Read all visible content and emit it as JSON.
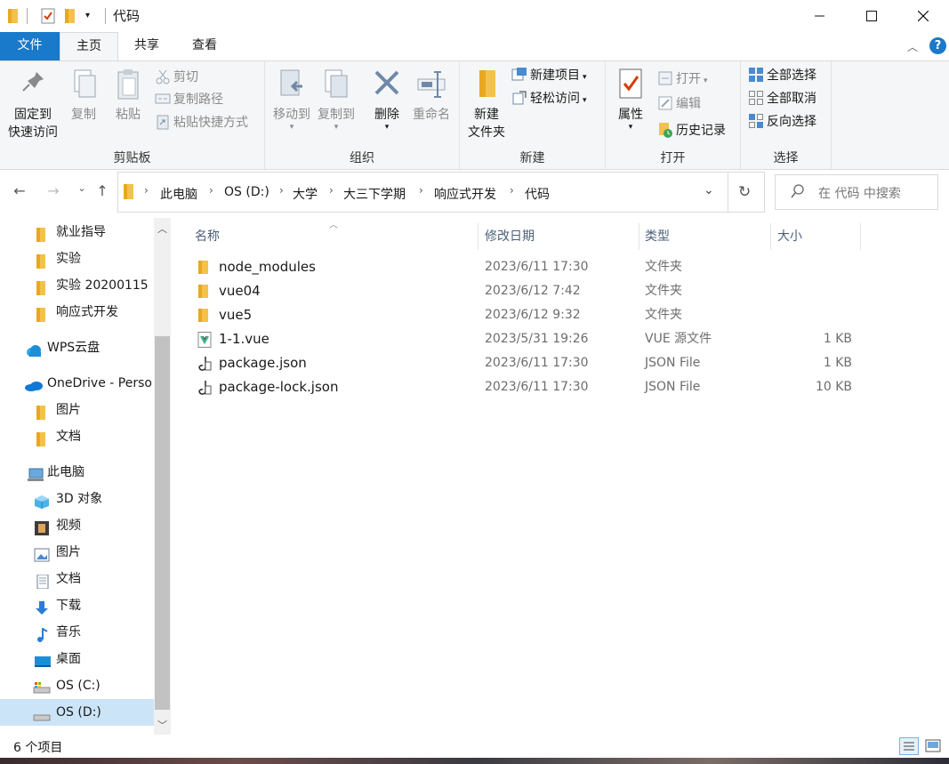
{
  "window": {
    "title": "代码"
  },
  "colors": {
    "accent": "#1979ca",
    "folder": "#f3c24b",
    "selection": "#cce4f7"
  },
  "tabs": {
    "file": "文件",
    "home": "主页",
    "share": "共享",
    "view": "查看"
  },
  "ribbon": {
    "clipboard": {
      "label": "剪贴板",
      "pin_line1": "固定到",
      "pin_line2": "快速访问",
      "copy": "复制",
      "paste": "粘贴",
      "cut": "剪切",
      "copy_path": "复制路径",
      "paste_shortcut": "粘贴快捷方式"
    },
    "organize": {
      "label": "组织",
      "move_to": "移动到",
      "copy_to": "复制到",
      "delete": "删除",
      "rename": "重命名"
    },
    "new": {
      "label": "新建",
      "new_folder_line1": "新建",
      "new_folder_line2": "文件夹",
      "new_item": "新建项目",
      "easy_access": "轻松访问"
    },
    "open": {
      "label": "打开",
      "properties": "属性",
      "open": "打开",
      "edit": "编辑",
      "history": "历史记录"
    },
    "select": {
      "label": "选择",
      "select_all": "全部选择",
      "select_none": "全部取消",
      "invert": "反向选择"
    }
  },
  "address": {
    "crumbs": [
      "此电脑",
      "OS (D:)",
      "大学",
      "大三下学期",
      "响应式开发",
      "代码"
    ]
  },
  "search": {
    "placeholder": "在 代码 中搜索"
  },
  "navpane": {
    "items": [
      {
        "label": "就业指导",
        "icon": "folder-icon"
      },
      {
        "label": "实验",
        "icon": "folder-icon"
      },
      {
        "label": "实验 20200115",
        "icon": "folder-icon"
      },
      {
        "label": "响应式开发",
        "icon": "folder-icon"
      },
      {
        "label": "WPS云盘",
        "icon": "cloud-icon"
      },
      {
        "label": "OneDrive - Perso",
        "icon": "onedrive-icon"
      },
      {
        "label": "图片",
        "icon": "folder-icon"
      },
      {
        "label": "文档",
        "icon": "folder-icon"
      },
      {
        "label": "此电脑",
        "icon": "computer-icon"
      },
      {
        "label": "3D 对象",
        "icon": "cube-icon"
      },
      {
        "label": "视频",
        "icon": "film-icon"
      },
      {
        "label": "图片",
        "icon": "picture-icon"
      },
      {
        "label": "文档",
        "icon": "document-icon"
      },
      {
        "label": "下载",
        "icon": "download-icon"
      },
      {
        "label": "音乐",
        "icon": "music-icon"
      },
      {
        "label": "桌面",
        "icon": "desktop-icon"
      },
      {
        "label": "OS (C:)",
        "icon": "drive-c-icon"
      },
      {
        "label": "OS (D:)",
        "icon": "drive-d-icon"
      }
    ]
  },
  "list": {
    "headers": {
      "name": "名称",
      "date": "修改日期",
      "type": "类型",
      "size": "大小"
    },
    "rows": [
      {
        "name": "node_modules",
        "date": "2023/6/11 17:30",
        "type": "文件夹",
        "size": "",
        "icon": "folder-icon"
      },
      {
        "name": "vue04",
        "date": "2023/6/12 7:42",
        "type": "文件夹",
        "size": "",
        "icon": "folder-icon"
      },
      {
        "name": "vue5",
        "date": "2023/6/12 9:32",
        "type": "文件夹",
        "size": "",
        "icon": "folder-icon"
      },
      {
        "name": "1-1.vue",
        "date": "2023/5/31 19:26",
        "type": "VUE 源文件",
        "size": "1 KB",
        "icon": "vue-file-icon"
      },
      {
        "name": "package.json",
        "date": "2023/6/11 17:30",
        "type": "JSON File",
        "size": "1 KB",
        "icon": "json-file-icon"
      },
      {
        "name": "package-lock.json",
        "date": "2023/6/11 17:30",
        "type": "JSON File",
        "size": "10 KB",
        "icon": "json-file-icon"
      }
    ]
  },
  "status": {
    "count": "6 个项目"
  }
}
